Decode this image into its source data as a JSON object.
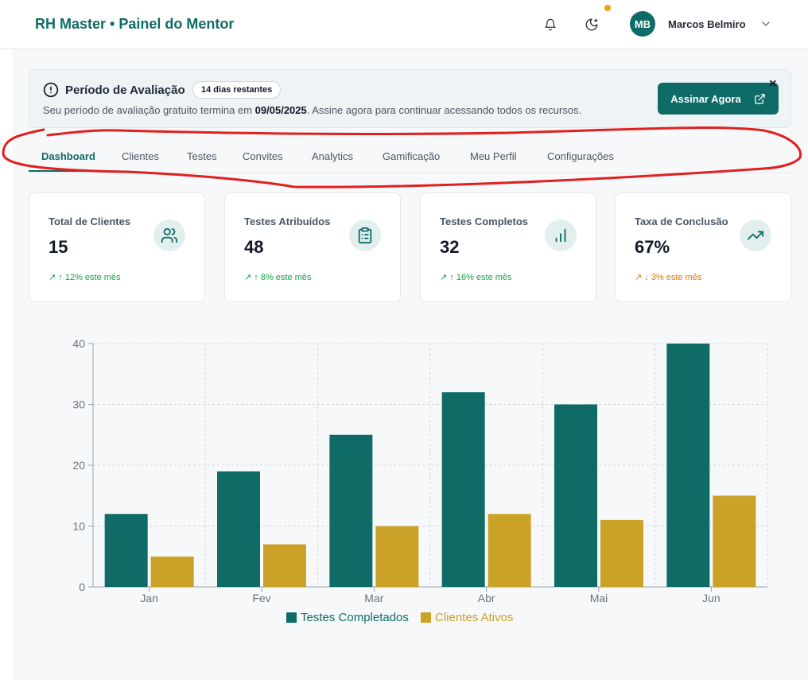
{
  "header": {
    "title": "RH Master • Painel do Mentor",
    "icons": [
      "bell-icon",
      "theme-toggle-icon"
    ],
    "user": {
      "initials": "MB",
      "name": "Marcos Belmiro"
    }
  },
  "banner": {
    "title": "Período de Avaliação",
    "badge": "14 dias restantes",
    "text_before": "Seu período de avaliação gratuito termina em ",
    "date": "09/05/2025",
    "text_after": ". Assine agora para continuar acessando todos os recursos.",
    "cta": "Assinar Agora",
    "close": "×"
  },
  "tabs": [
    "Dashboard",
    "Clientes",
    "Testes",
    "Convites",
    "Analytics",
    "Gamificação",
    "Meu Perfil",
    "Configurações"
  ],
  "active_tab": "Dashboard",
  "cards": [
    {
      "label": "Total de Clientes",
      "value": "15",
      "trend": "↗ ↑ 12% este mês",
      "icon": "users-icon"
    },
    {
      "label": "Testes Atribuídos",
      "value": "48",
      "trend": "↗ ↑ 8% este mês",
      "icon": "clipboard-icon"
    },
    {
      "label": "Testes Completos",
      "value": "32",
      "trend": "↗ ↑ 16% este mês",
      "icon": "bar-chart-icon"
    },
    {
      "label": "Taxa de Conclusão",
      "value": "67%",
      "trend": "↗ ↓ 3% este mês",
      "icon": "trending-up-icon"
    }
  ],
  "colors": {
    "primary": "#0f6b66",
    "accent": "#c9a227",
    "annotation": "#e02020"
  },
  "chart_data": {
    "type": "bar",
    "categories": [
      "Jan",
      "Fev",
      "Mar",
      "Abr",
      "Mai",
      "Jun"
    ],
    "series": [
      {
        "name": "Testes Completados",
        "values": [
          12,
          19,
          25,
          32,
          30,
          40
        ],
        "color": "#0f6b66"
      },
      {
        "name": "Clientes Ativos",
        "values": [
          5,
          7,
          10,
          12,
          11,
          15
        ],
        "color": "#c9a227"
      }
    ],
    "ylim": [
      0,
      40
    ],
    "yticks": [
      0,
      10,
      20,
      30,
      40
    ],
    "grid": true,
    "legend": "bottom"
  }
}
